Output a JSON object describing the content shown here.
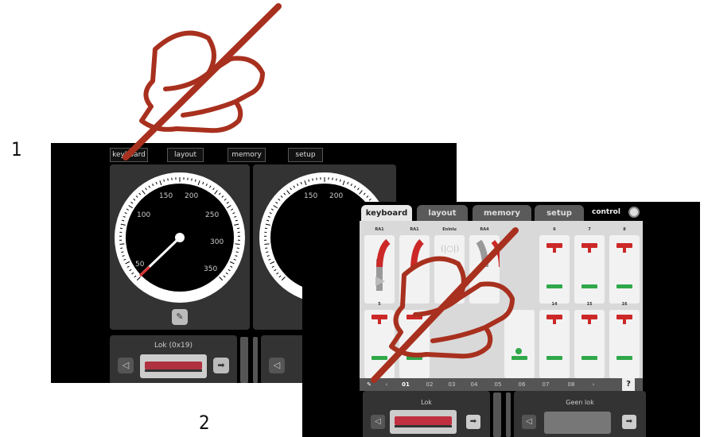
{
  "steps": {
    "one": "1",
    "two": "2"
  },
  "screen1": {
    "tabs": [
      "keyboard",
      "layout",
      "memory",
      "setup"
    ],
    "speedometer": {
      "labels": [
        "50",
        "100",
        "150",
        "200",
        "250",
        "300",
        "350"
      ]
    },
    "right_speedometer_labels": [
      "150",
      "200"
    ],
    "loco_label": "Lok (0x19)"
  },
  "screen2": {
    "tabs": [
      "keyboard",
      "layout",
      "memory",
      "setup"
    ],
    "control_label": "control",
    "top_labels": [
      "RA1",
      "RA1",
      "Enlnlu",
      "RA4",
      "6",
      "7",
      "8"
    ],
    "bottom_labels": [
      "5",
      "14",
      "15",
      "16"
    ],
    "pages": [
      "01",
      "02",
      "03",
      "04",
      "05",
      "06",
      "07",
      "08"
    ],
    "help": "?",
    "loco_left": "Lok",
    "loco_right": "Geen lok"
  },
  "colors": {
    "accent": "#a8301e",
    "signal_red": "#cc2828",
    "signal_green": "#2fa84a"
  }
}
